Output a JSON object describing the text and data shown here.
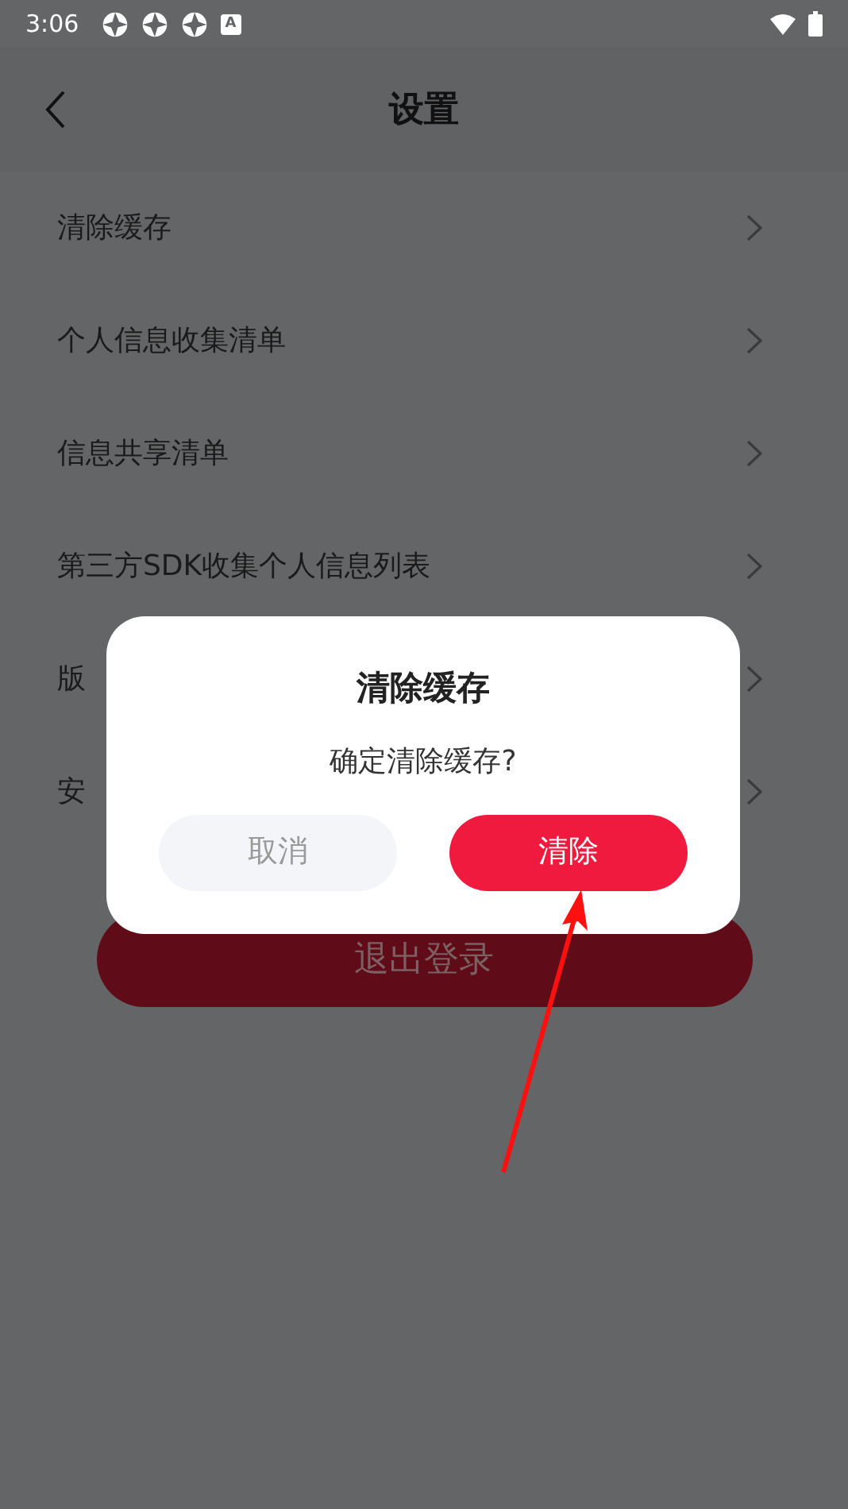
{
  "status_bar": {
    "time": "3:06",
    "badge": "A"
  },
  "header": {
    "title": "设置"
  },
  "items": [
    {
      "label": "清除缓存"
    },
    {
      "label": "个人信息收集清单"
    },
    {
      "label": "信息共享清单"
    },
    {
      "label": "第三方SDK收集个人信息列表"
    },
    {
      "label": "版"
    },
    {
      "label": "安"
    }
  ],
  "logout_button": "退出登录",
  "dialog": {
    "title": "清除缓存",
    "message": "确定清除缓存?",
    "cancel": "取消",
    "confirm": "清除"
  }
}
